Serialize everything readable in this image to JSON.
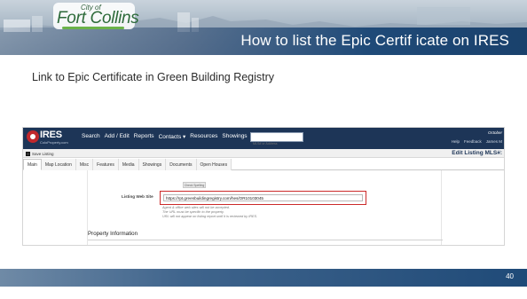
{
  "header": {
    "logo_city": "City of",
    "logo_name": "Fort Collins",
    "title": "How to list the Epic Certif icate on IRES",
    "brand_color": "#1f4a78"
  },
  "slide": {
    "subtitle": "Link to Epic Certificate in Green Building Registry",
    "page_number": "40"
  },
  "ires": {
    "logo_text": "IRES",
    "logo_sub": "ColoProperty.com",
    "nav": [
      "Search",
      "Add / Edit",
      "Reports",
      "Contacts ▾",
      "Resources",
      "Showings"
    ],
    "search_placeholder": "MLS# or Address",
    "month": "October",
    "utility_links": [
      "Help",
      "Feedback",
      "James M"
    ],
    "save_label": "Save Listing",
    "edit_title": "Edit Listing MLS#:",
    "tabs": [
      {
        "label": "Main",
        "active": true
      },
      {
        "label": "Map Location",
        "active": false
      },
      {
        "label": "Misc",
        "active": false
      },
      {
        "label": "Features",
        "active": false
      },
      {
        "label": "Media",
        "active": false
      },
      {
        "label": "Showings",
        "active": false
      },
      {
        "label": "Documents",
        "active": false
      },
      {
        "label": "Open Houses",
        "active": false
      }
    ],
    "spell_button": "Check Spelling",
    "website_label": "Listing Web Site",
    "website_value": "https://rpt.greenbuildingregistry.com/hes/OR10103045",
    "notes": [
      "Agent & office web sites will not be accepted.",
      "The URL must be specific to the property.",
      "URL will not appear on listing report until it is reviewed by IRES."
    ],
    "section_heading": "Property Information",
    "highlight_color": "#cc2a2a",
    "nav_color": "#1d3557"
  }
}
